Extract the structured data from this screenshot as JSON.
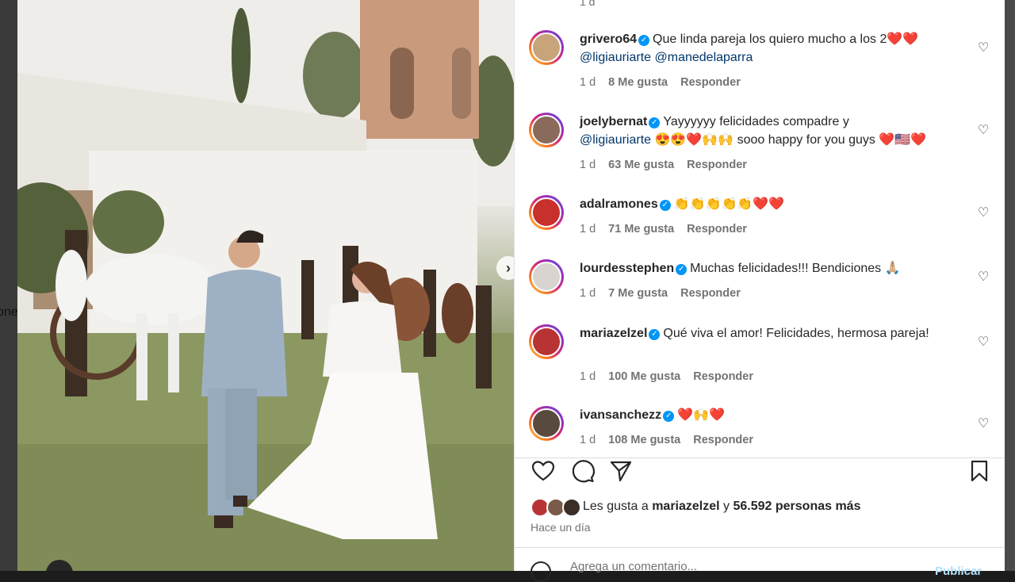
{
  "backdrop": {
    "edge_text": "one"
  },
  "photo": {
    "next_arrow": "›"
  },
  "comments": {
    "top_stub": "1 d",
    "items": [
      {
        "username": "grivero64",
        "text_parts": [
          "Que linda pareja los quiero mucho a los 2❤️❤️"
        ],
        "mentions": "@ligiauriarte @manedelaparra",
        "time": "1 d",
        "likes": "8 Me gusta",
        "reply": "Responder",
        "avatar_color": "#c7a47a"
      },
      {
        "username": "joelybernat",
        "text_parts": [
          "Yayyyyyy felicidades compadre y"
        ],
        "mentions": "@ligiauriarte",
        "after_mention": " 😍😍❤️🙌🙌 sooo happy for you guys ❤️🇺🇸❤️",
        "time": "1 d",
        "likes": "63 Me gusta",
        "reply": "Responder",
        "avatar_color": "#8a6a5a"
      },
      {
        "username": "adalramones",
        "text_parts": [
          "👏👏👏👏👏❤️❤️"
        ],
        "time": "1 d",
        "likes": "71 Me gusta",
        "reply": "Responder",
        "avatar_color": "#c8302c"
      },
      {
        "username": "lourdesstephen",
        "text_parts": [
          "Muchas felicidades!!! Bendiciones 🙏🏼"
        ],
        "time": "1 d",
        "likes": "7 Me gusta",
        "reply": "Responder",
        "avatar_color": "#d9d4cf"
      },
      {
        "username": "mariazelzel",
        "text_parts": [
          "Qué viva el amor! Felicidades, hermosa pareja!"
        ],
        "time": "1 d",
        "likes": "100 Me gusta",
        "reply": "Responder",
        "avatar_color": "#b83434"
      },
      {
        "username": "ivansanchezz",
        "text_parts": [
          "❤️🙌❤️"
        ],
        "time": "1 d",
        "likes": "108 Me gusta",
        "reply": "Responder",
        "avatar_color": "#5a4a3e"
      }
    ]
  },
  "likes": {
    "prefix": "Les gusta a",
    "user": "mariazelzel",
    "middle": "y",
    "count": "56.592 personas más"
  },
  "posted_time": "Hace un día",
  "add_comment_placeholder": "Agrega un comentario...",
  "post_label": "Publicar",
  "icons": {
    "like": "heart-icon",
    "comment": "comment-icon",
    "share": "send-icon",
    "save": "bookmark-icon"
  }
}
